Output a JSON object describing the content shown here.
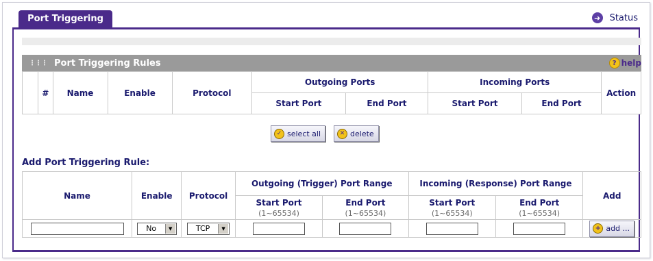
{
  "header": {
    "tab_label": "Port Triggering",
    "status_link": "Status"
  },
  "rules_section": {
    "title": "Port Triggering Rules",
    "help_label": "help",
    "columns": {
      "hash": "#",
      "name": "Name",
      "enable": "Enable",
      "protocol": "Protocol",
      "outgoing": "Outgoing Ports",
      "incoming": "Incoming Ports",
      "action": "Action",
      "start_port": "Start Port",
      "end_port": "End Port"
    },
    "select_all_label": "select all",
    "delete_label": "delete"
  },
  "add_section": {
    "title": "Add Port Triggering Rule:",
    "columns": {
      "name": "Name",
      "enable": "Enable",
      "protocol": "Protocol",
      "outgoing": "Outgoing (Trigger) Port Range",
      "incoming": "Incoming (Response) Port Range",
      "add": "Add",
      "start_port": "Start Port",
      "end_port": "End Port",
      "range_hint": "(1~65534)"
    },
    "inputs": {
      "name_value": "",
      "enable_selected": "No",
      "protocol_selected": "TCP",
      "out_start_value": "",
      "out_end_value": "",
      "in_start_value": "",
      "in_end_value": ""
    },
    "add_button_label": "add ..."
  },
  "colors": {
    "accent": "#4a2a8a",
    "section_bar": "#9a9a9a",
    "button_icon": "#f2c21a"
  }
}
